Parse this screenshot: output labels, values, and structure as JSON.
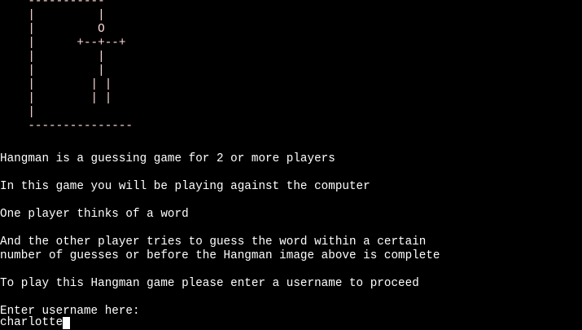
{
  "hangman_art": [
    "    -----------",
    "    |         |",
    "    |         O",
    "    |      +--+--+",
    "    |         |",
    "    |         |",
    "    |        | |",
    "    |        | |",
    "    |",
    "    ---------------"
  ],
  "intro": {
    "line1": "Hangman is a guessing game for 2 or more players",
    "line2": "In this game you will be playing against the computer",
    "line3": "One player thinks of a word",
    "line4a": "And the other player tries to guess the word within a certain",
    "line4b": "number of guesses or before the Hangman image above is complete",
    "line5": "To play this Hangman game please enter a username to proceed"
  },
  "prompt": {
    "label": "Enter username here:",
    "value": "charlotte"
  },
  "colors": {
    "background": "#000000",
    "text": "#ffffff",
    "art": "#ffdcdc"
  }
}
